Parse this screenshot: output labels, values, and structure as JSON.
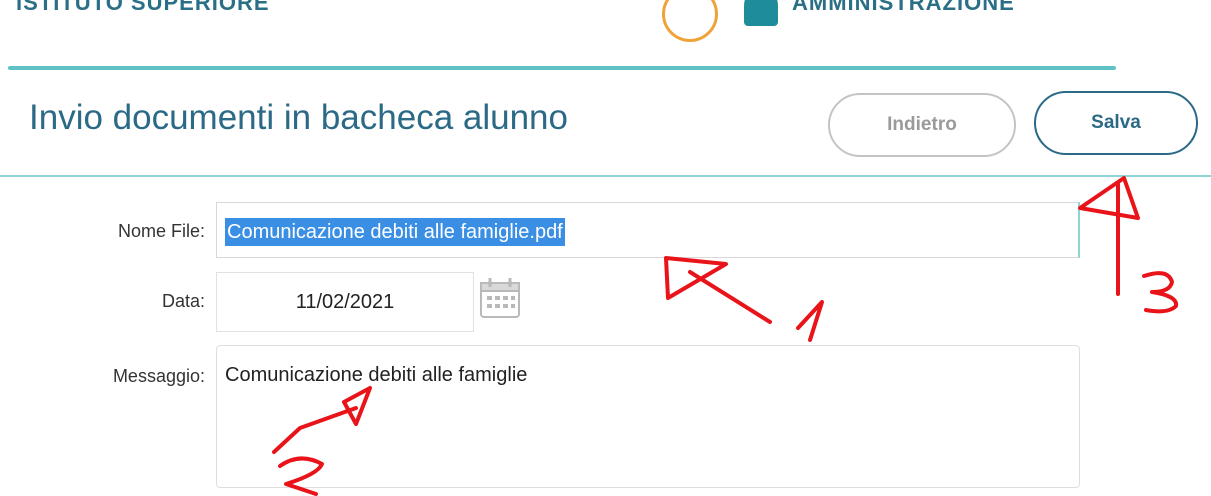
{
  "header": {
    "school_name": "ISTITUTO SUPERIORE",
    "user_name": "AMMINISTRAZIONE"
  },
  "page": {
    "title": "Invio documenti in bacheca alunno"
  },
  "actions": {
    "back_label": "Indietro",
    "save_label": "Salva"
  },
  "form": {
    "file_name_label": "Nome File:",
    "file_name_value": "Comunicazione debiti alle famiglie.pdf",
    "date_label": "Data:",
    "date_value": "11/02/2021",
    "message_label": "Messaggio:",
    "message_value": "Comunicazione debiti alle famiglie"
  },
  "annotations": {
    "marker_1": "1",
    "marker_2": "2",
    "marker_3": "3",
    "color": "#e8141a"
  },
  "colors": {
    "brand": "#2b6a86",
    "accent_rule": "#5fc3c6",
    "selection": "#3a8fe5",
    "alert": "#f0a23a"
  },
  "icons": {
    "alert": "alert-circle-icon",
    "user": "user-icon",
    "calendar": "calendar-icon"
  }
}
